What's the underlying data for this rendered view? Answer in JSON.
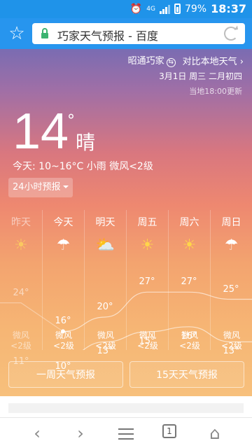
{
  "status": {
    "battery": "79%",
    "time": "18:37",
    "network": "4G"
  },
  "browser": {
    "url_title": "巧家天气预报 - 百度"
  },
  "weather": {
    "location": "昭通巧家",
    "compare": "对比本地天气",
    "date": "3月1日 周三 二月初四",
    "update": "当地18:00更新",
    "temp": "14",
    "deg": "°",
    "condition": "晴",
    "today": "今天:  10~16°C 小雨 微风<2级",
    "btn24": "24小时预报"
  },
  "forecast": [
    {
      "day": "昨天",
      "icon": "sun-icon",
      "high": "24°",
      "low": "11°",
      "wind": "微风",
      "level": "<2级",
      "past": true
    },
    {
      "day": "今天",
      "icon": "rain-icon",
      "high": "16°",
      "low": "10°",
      "wind": "微风",
      "level": "<2级"
    },
    {
      "day": "明天",
      "icon": "partly-cloudy-icon",
      "high": "20°",
      "low": "13°",
      "wind": "微风",
      "level": "<2级"
    },
    {
      "day": "周五",
      "icon": "sun-icon",
      "high": "27°",
      "low": "15°",
      "wind": "微风",
      "level": "<2级"
    },
    {
      "day": "周六",
      "icon": "sun-icon",
      "high": "27°",
      "low": "16°",
      "wind": "微风",
      "level": "<2级"
    },
    {
      "day": "周日",
      "icon": "rain-icon",
      "high": "25°",
      "low": "13°",
      "wind": "微风",
      "level": "<2级"
    }
  ],
  "buttons": {
    "week": "一周天气预报",
    "fifteen": "15天天气预报"
  },
  "nav": {
    "tabs_count": "1"
  },
  "colors": {
    "accent": "#2795ee"
  }
}
